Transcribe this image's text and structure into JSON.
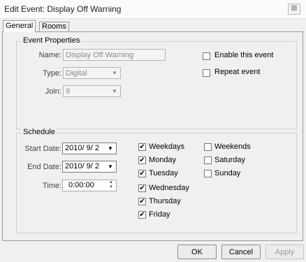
{
  "window": {
    "title": "Edit Event: Display Off Warning",
    "close_glyph": "⊠"
  },
  "tabs": [
    {
      "label": "General"
    },
    {
      "label": "Rooms"
    }
  ],
  "event_properties": {
    "group_label": "Event Properties",
    "name_label": "Name:",
    "name_value": "Display Off Warning",
    "type_label": "Type:",
    "type_value": "Digital",
    "join_label": "Join:",
    "join_value": "9",
    "enable_label": "Enable this event",
    "enable_checked": false,
    "repeat_label": "Repeat event",
    "repeat_checked": false
  },
  "schedule": {
    "group_label": "Schedule",
    "start_label": "Start Date:",
    "start_value": "2010/ 9/ 2",
    "end_label": "End Date:",
    "end_value": "2010/ 9/ 2",
    "time_label": "Time:",
    "time_value": "0:00:00",
    "days": [
      {
        "label": "Weekdays",
        "checked": true
      },
      {
        "label": "Monday",
        "checked": true
      },
      {
        "label": "Tuesday",
        "checked": true
      },
      {
        "label": "Wednesday",
        "checked": true
      },
      {
        "label": "Thursday",
        "checked": true
      },
      {
        "label": "Friday",
        "checked": true
      },
      {
        "label": "Weekends",
        "checked": false
      },
      {
        "label": "Saturday",
        "checked": false
      },
      {
        "label": "Sunday",
        "checked": false
      }
    ]
  },
  "buttons": {
    "ok": "OK",
    "cancel": "Cancel",
    "apply": "Apply"
  },
  "icons": {
    "dropdown": "▼",
    "spin_up": "▲",
    "spin_down": "▼",
    "check": "✔"
  }
}
